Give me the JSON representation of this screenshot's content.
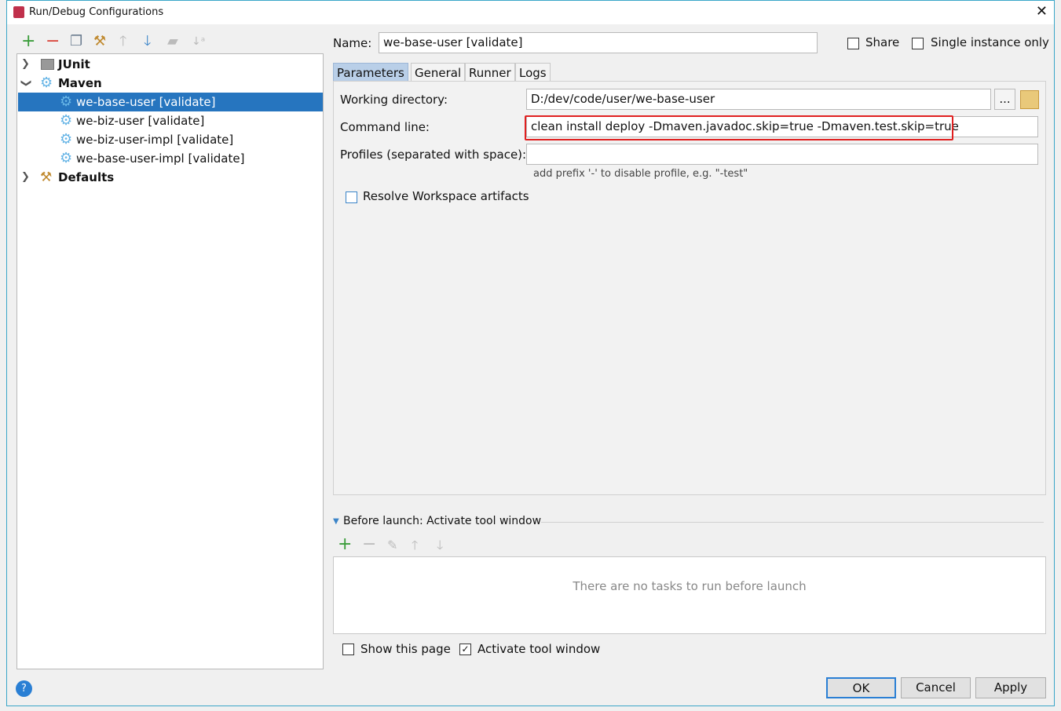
{
  "window": {
    "title": "Run/Debug Configurations"
  },
  "toolbar": [
    "add-icon",
    "remove-icon",
    "copy-icon",
    "edit-defaults-icon",
    "move-up-icon",
    "move-down-icon",
    "folder-icon",
    "sort-icon"
  ],
  "tree": {
    "groups": [
      {
        "label": "JUnit"
      },
      {
        "label": "Maven"
      },
      {
        "label": "Defaults"
      }
    ],
    "maven_items": [
      "we-base-user [validate]",
      "we-biz-user [validate]",
      "we-biz-user-impl [validate]",
      "we-base-user-impl [validate]"
    ],
    "selected": "we-base-user [validate]"
  },
  "form": {
    "name_label": "Name:",
    "name_value": "we-base-user [validate]",
    "share_label": "Share",
    "share_checked": false,
    "single_label": "Single instance only",
    "single_checked": false,
    "tabs": [
      "Parameters",
      "General",
      "Runner",
      "Logs"
    ],
    "active_tab": "Parameters",
    "workdir_label": "Working directory:",
    "workdir_value": "D:/dev/code/user/we-base-user",
    "browse_label": "...",
    "cmd_label": "Command line:",
    "cmd_value": "clean install deploy -Dmaven.javadoc.skip=true -Dmaven.test.skip=true",
    "profiles_label": "Profiles (separated with space):",
    "profiles_value": "",
    "profiles_hint": "add prefix '-' to disable profile, e.g. \"-test\"",
    "resolve_label": "Resolve Workspace artifacts",
    "resolve_checked": false
  },
  "before_launch": {
    "title": "Before launch: Activate tool window",
    "empty_text": "There are no tasks to run before launch"
  },
  "footer": {
    "show_page_label": "Show this page",
    "show_page_checked": false,
    "activate_label": "Activate tool window",
    "activate_checked": true,
    "ok": "OK",
    "cancel": "Cancel",
    "apply": "Apply"
  },
  "colors": {
    "selection": "#2675bf",
    "highlight_box": "#e02020",
    "add_green": "#3a9c3a",
    "remove_red": "#d9443a"
  }
}
